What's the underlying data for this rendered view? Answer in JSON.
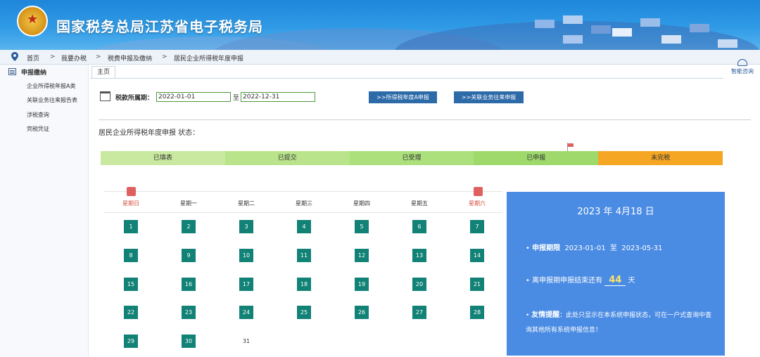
{
  "header": {
    "title": "国家税务总局江苏省电子税务局"
  },
  "breadcrumb": [
    {
      "label": "首页"
    },
    {
      "label": "我要办税"
    },
    {
      "label": "税费申报及缴纳"
    },
    {
      "label": "居民企业所得税年度申报"
    }
  ],
  "sidebar": {
    "heading": "申报缴纳",
    "items": [
      {
        "label": "企业所得税年报A类"
      },
      {
        "label": "关联业务往来报告表"
      },
      {
        "label": "涉税查询"
      },
      {
        "label": "完税凭证"
      }
    ]
  },
  "tab": {
    "label": "主页"
  },
  "help": {
    "label": "智能咨询"
  },
  "filter": {
    "period_label": "税款所属期：",
    "from_value": "2022-01-01",
    "to_label": "至",
    "to_value": "2022-12-31",
    "btn_a": ">>所得税年度A申报",
    "btn_related": ">>关联业务往来申报"
  },
  "status_title": "居民企业所得税年度申报 状态：",
  "progress": [
    {
      "label": "已填表",
      "color": "#c9e9a0"
    },
    {
      "label": "已提交",
      "color": "#b9e48c"
    },
    {
      "label": "已受理",
      "color": "#ace07c"
    },
    {
      "label": "已申报",
      "color": "#9fd96c"
    },
    {
      "label": "未完税",
      "color": "#f5a623"
    }
  ],
  "calendar": {
    "weekdays": [
      "星期日",
      "星期一",
      "星期二",
      "星期三",
      "星期四",
      "星期五",
      "星期六"
    ],
    "rows": [
      [
        "1",
        "2",
        "3",
        "4",
        "5",
        "6",
        "7"
      ],
      [
        "8",
        "9",
        "10",
        "11",
        "12",
        "13",
        "14"
      ],
      [
        "15",
        "16",
        "17",
        "18",
        "19",
        "20",
        "21"
      ],
      [
        "22",
        "23",
        "24",
        "25",
        "26",
        "27",
        "28"
      ],
      [
        "29",
        "30",
        "31"
      ]
    ]
  },
  "panel": {
    "date": "2023 年 4月18 日",
    "deadline_label": "申报期限",
    "deadline_from": "2023-01-01",
    "deadline_to_label": "至",
    "deadline_to": "2023-05-31",
    "remaining_prefix": "离申报期申报结束还有",
    "remaining_days": "44",
    "remaining_suffix": "天",
    "tip_label": "友情提醒",
    "tip_text": "：此处只显示在本系统申报状态，可在一户式查询中查询其他所有系统申报信息！"
  },
  "colors": {
    "header_blue": "#2f9ae6",
    "day_green": "#128277",
    "panel_blue": "#4a8be3",
    "button_blue": "#2d6aa8"
  }
}
